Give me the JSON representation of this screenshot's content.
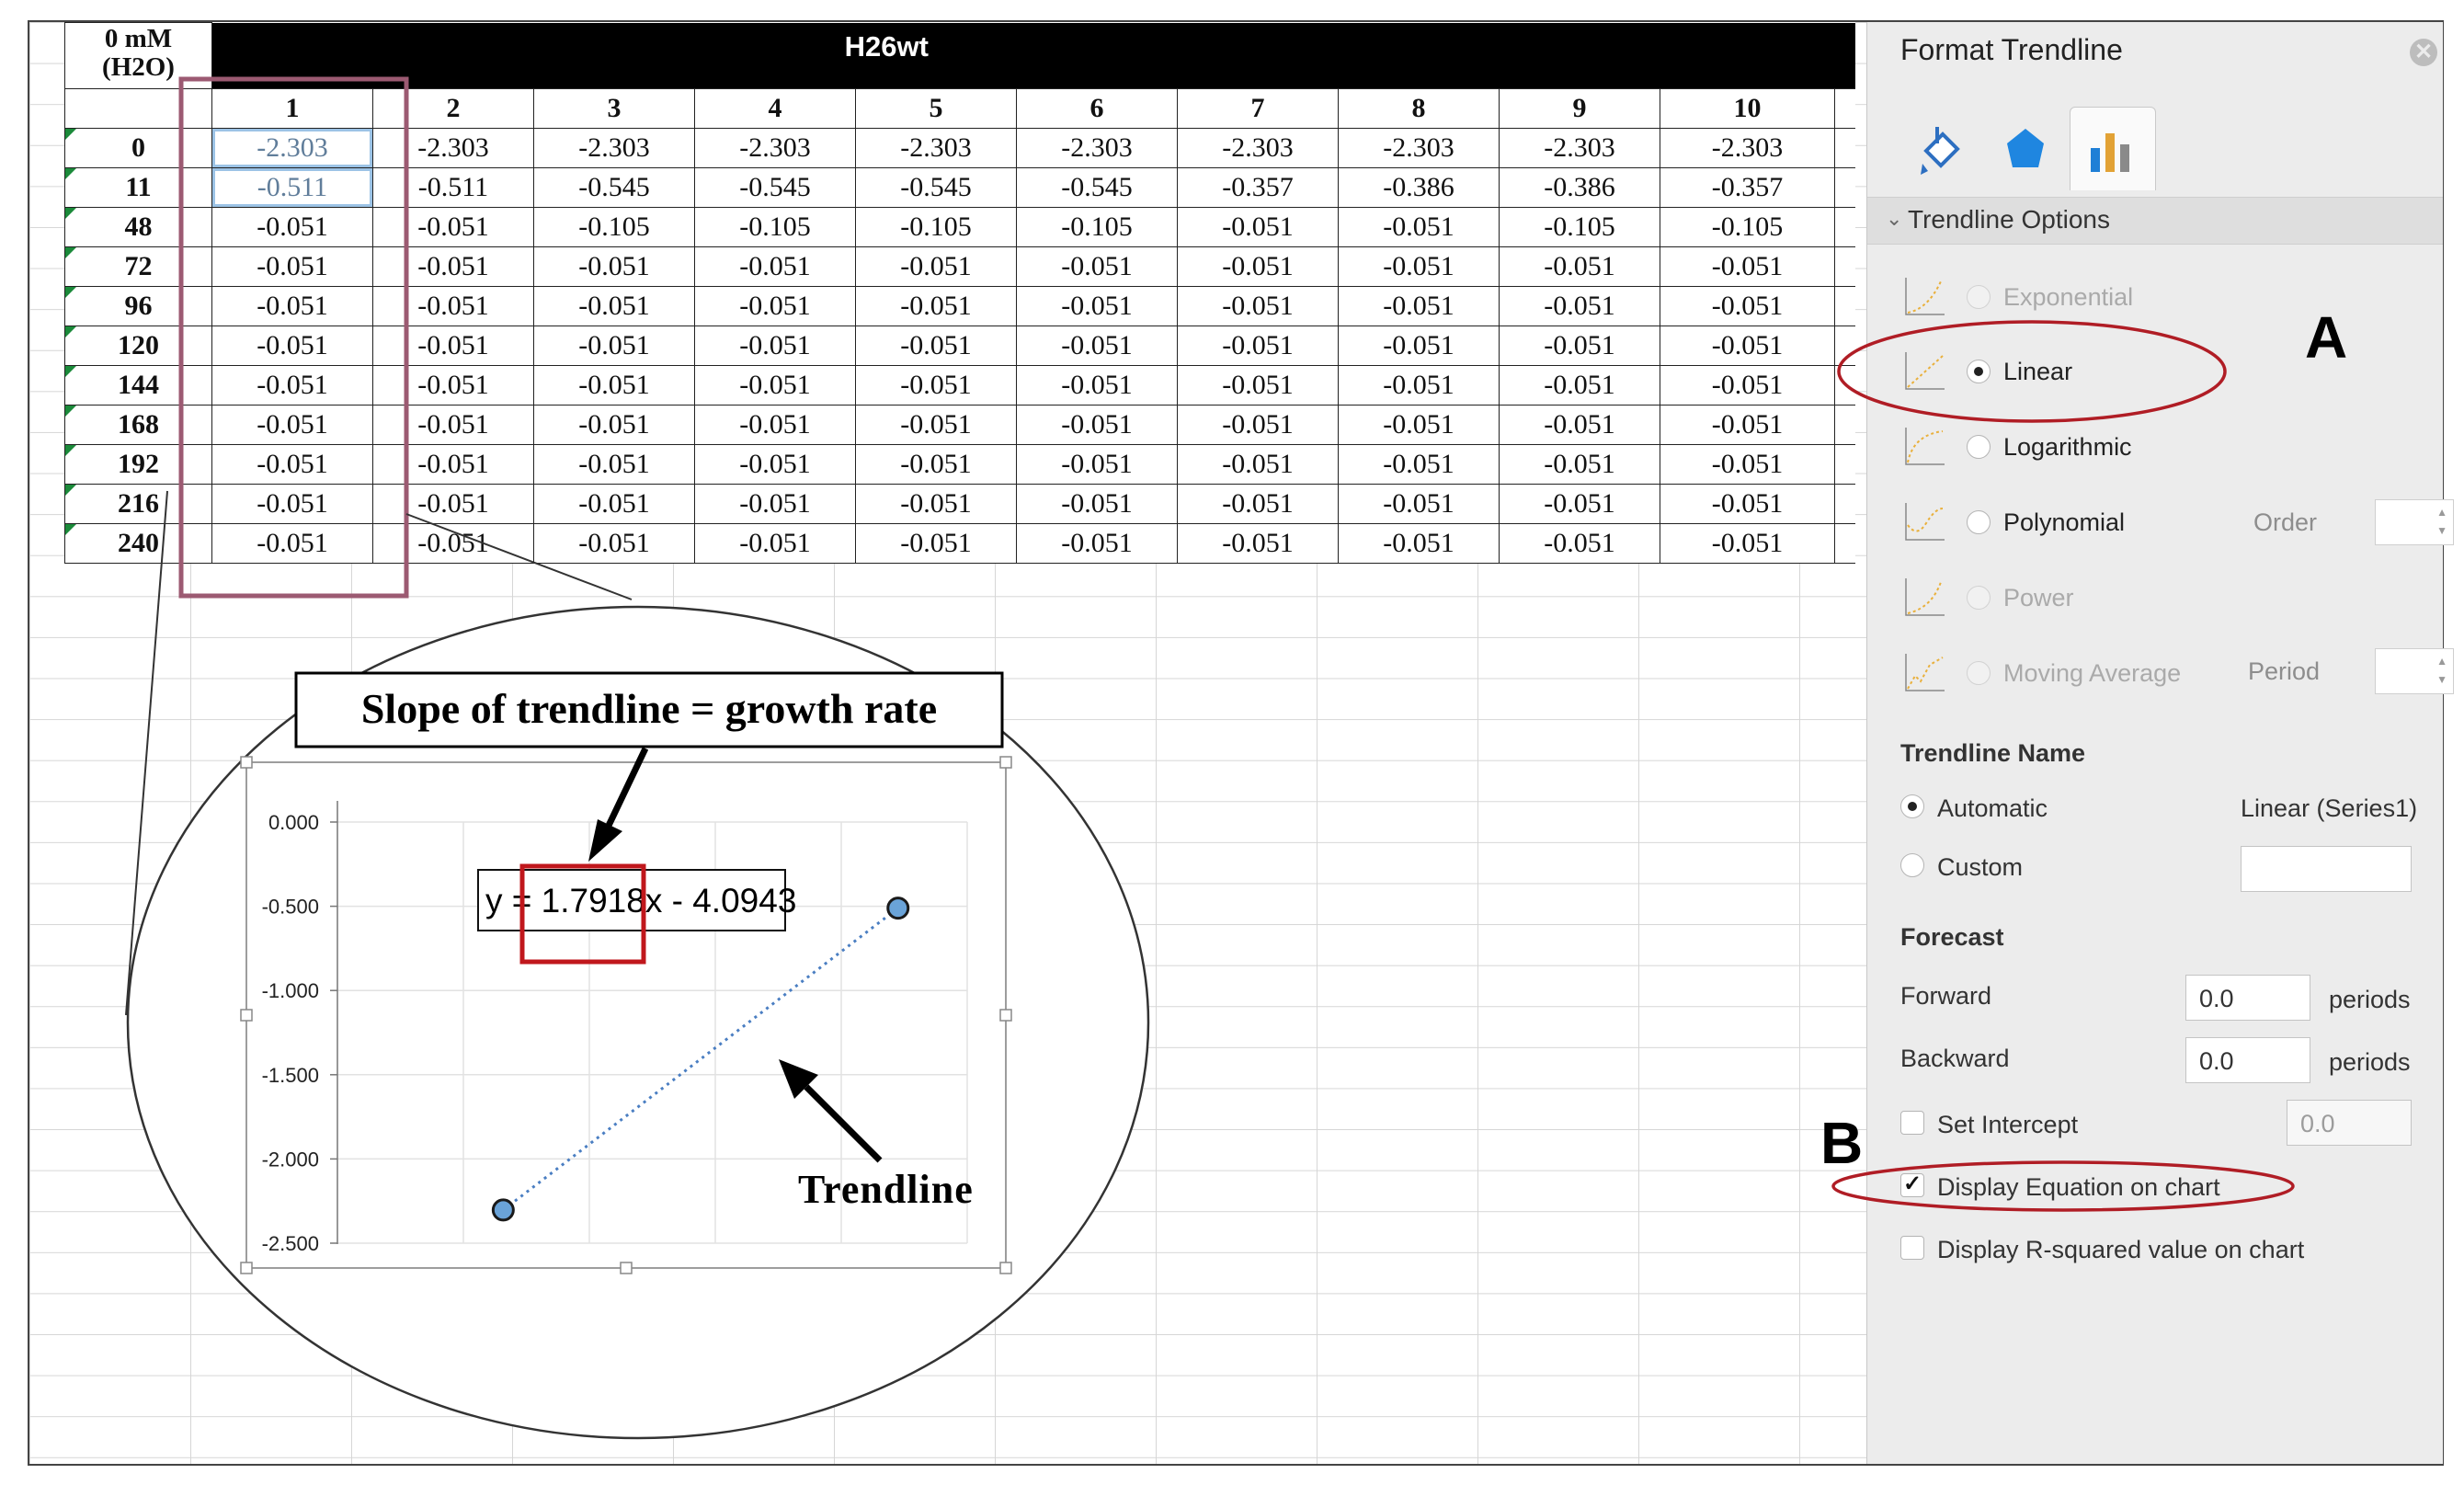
{
  "sheet": {
    "corner_line1": "0 mM",
    "corner_line2": "(H2O)",
    "title": "H26wt",
    "columns": [
      "1",
      "2",
      "3",
      "4",
      "5",
      "6",
      "7",
      "8",
      "9",
      "10"
    ],
    "rows": [
      {
        "label": "0",
        "values": [
          "-2.303",
          "-2.303",
          "-2.303",
          "-2.303",
          "-2.303",
          "-2.303",
          "-2.303",
          "-2.303",
          "-2.303",
          "-2.303"
        ]
      },
      {
        "label": "11",
        "values": [
          "-0.511",
          "-0.511",
          "-0.545",
          "-0.545",
          "-0.545",
          "-0.545",
          "-0.357",
          "-0.386",
          "-0.386",
          "-0.357"
        ]
      },
      {
        "label": "48",
        "values": [
          "-0.051",
          "-0.051",
          "-0.105",
          "-0.105",
          "-0.105",
          "-0.105",
          "-0.051",
          "-0.051",
          "-0.105",
          "-0.105"
        ]
      },
      {
        "label": "72",
        "values": [
          "-0.051",
          "-0.051",
          "-0.051",
          "-0.051",
          "-0.051",
          "-0.051",
          "-0.051",
          "-0.051",
          "-0.051",
          "-0.051"
        ]
      },
      {
        "label": "96",
        "values": [
          "-0.051",
          "-0.051",
          "-0.051",
          "-0.051",
          "-0.051",
          "-0.051",
          "-0.051",
          "-0.051",
          "-0.051",
          "-0.051"
        ]
      },
      {
        "label": "120",
        "values": [
          "-0.051",
          "-0.051",
          "-0.051",
          "-0.051",
          "-0.051",
          "-0.051",
          "-0.051",
          "-0.051",
          "-0.051",
          "-0.051"
        ]
      },
      {
        "label": "144",
        "values": [
          "-0.051",
          "-0.051",
          "-0.051",
          "-0.051",
          "-0.051",
          "-0.051",
          "-0.051",
          "-0.051",
          "-0.051",
          "-0.051"
        ]
      },
      {
        "label": "168",
        "values": [
          "-0.051",
          "-0.051",
          "-0.051",
          "-0.051",
          "-0.051",
          "-0.051",
          "-0.051",
          "-0.051",
          "-0.051",
          "-0.051"
        ]
      },
      {
        "label": "192",
        "values": [
          "-0.051",
          "-0.051",
          "-0.051",
          "-0.051",
          "-0.051",
          "-0.051",
          "-0.051",
          "-0.051",
          "-0.051",
          "-0.051"
        ]
      },
      {
        "label": "216",
        "values": [
          "-0.051",
          "-0.051",
          "-0.051",
          "-0.051",
          "-0.051",
          "-0.051",
          "-0.051",
          "-0.051",
          "-0.051",
          "-0.051"
        ]
      },
      {
        "label": "240",
        "values": [
          "-0.051",
          "-0.051",
          "-0.051",
          "-0.051",
          "-0.051",
          "-0.051",
          "-0.051",
          "-0.051",
          "-0.051",
          "-0.051"
        ]
      }
    ]
  },
  "annotations": {
    "slope_callout": "Slope of trendline = growth rate",
    "trendline_label": "Trendline",
    "equation_prefix": "y = ",
    "equation_slope": "1.7918x",
    "equation_suffix": " - 4.0943",
    "letter_a": "A",
    "letter_b": "B",
    "highlight_color": "#9c5a72",
    "ellipse_color": "#b01d25",
    "slope_box_color": "#c0171c"
  },
  "chart_data": {
    "type": "scatter",
    "title": "",
    "xlabel": "",
    "ylabel": "",
    "ylim": [
      -2.5,
      0
    ],
    "y_ticks": [
      "0.000",
      "-0.500",
      "-1.000",
      "-1.500",
      "-2.000",
      "-2.500"
    ],
    "x_gridlines": 5,
    "grid": true,
    "points": [
      {
        "x": 1,
        "y": -2.303
      },
      {
        "x": 2,
        "y": -0.511
      }
    ],
    "trendline": {
      "type": "linear",
      "slope": 1.7918,
      "intercept": -4.0943,
      "style": "dotted",
      "color": "#4a7ec2"
    },
    "point_color": "#6aa3d8"
  },
  "panel": {
    "title": "Format Trendline",
    "section": "Trendline Options",
    "options": [
      {
        "label": "Exponential",
        "selected": false,
        "enabled": false
      },
      {
        "label": "Linear",
        "selected": true,
        "enabled": true
      },
      {
        "label": "Logarithmic",
        "selected": false,
        "enabled": true
      },
      {
        "label": "Polynomial",
        "selected": false,
        "enabled": true
      },
      {
        "label": "Power",
        "selected": false,
        "enabled": false
      },
      {
        "label": "Moving Average",
        "selected": false,
        "enabled": false
      }
    ],
    "order_label": "Order",
    "period_label": "Period",
    "name_header": "Trendline Name",
    "automatic_label": "Automatic",
    "automatic_value": "Linear (Series1)",
    "custom_label": "Custom",
    "forecast_header": "Forecast",
    "forward_label": "Forward",
    "forward_value": "0.0",
    "backward_label": "Backward",
    "backward_value": "0.0",
    "periods_label": "periods",
    "set_intercept_label": "Set Intercept",
    "set_intercept_value": "0.0",
    "display_equation_label": "Display Equation on chart",
    "display_equation_checked": true,
    "display_r2_label": "Display R-squared value on chart",
    "display_r2_checked": false
  }
}
